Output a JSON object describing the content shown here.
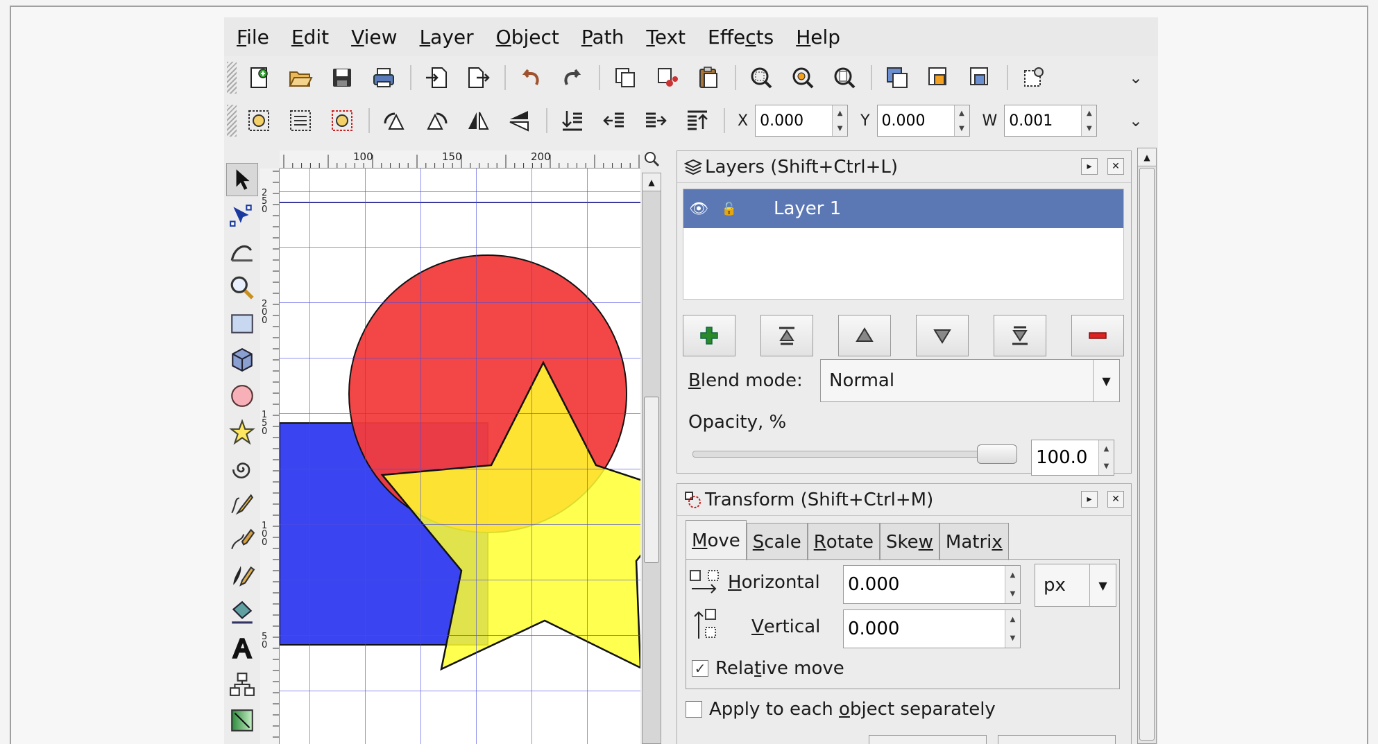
{
  "menubar": {
    "items": [
      {
        "pre": "",
        "u": "F",
        "post": "ile"
      },
      {
        "pre": "",
        "u": "E",
        "post": "dit"
      },
      {
        "pre": "",
        "u": "V",
        "post": "iew"
      },
      {
        "pre": "",
        "u": "L",
        "post": "ayer"
      },
      {
        "pre": "",
        "u": "O",
        "post": "bject"
      },
      {
        "pre": "",
        "u": "P",
        "post": "ath"
      },
      {
        "pre": "",
        "u": "T",
        "post": "ext"
      },
      {
        "pre": "Effe",
        "u": "c",
        "post": "ts"
      },
      {
        "pre": "",
        "u": "H",
        "post": "elp"
      }
    ]
  },
  "controls": {
    "x_label": "X",
    "x_value": "0.000",
    "y_label": "Y",
    "y_value": "0.000",
    "w_label": "W",
    "w_value": "0.001"
  },
  "ruler": {
    "h_labels": [
      "100",
      "150",
      "200"
    ],
    "v_labels": [
      "250",
      "200",
      "150",
      "100",
      "50"
    ]
  },
  "layers_panel": {
    "title": "Layers (Shift+Ctrl+L)",
    "layer_name": "Layer 1",
    "blend_label_u": "B",
    "blend_label_rest": "lend mode:",
    "blend_value": "Normal",
    "opacity_label": "Opacity, %",
    "opacity_value": "100.0",
    "opacity_fraction": 1.0
  },
  "transform_panel": {
    "title": "Transform (Shift+Ctrl+M)",
    "tabs": [
      {
        "u": "M",
        "rest": "ove"
      },
      {
        "u": "S",
        "rest": "cale"
      },
      {
        "u": "R",
        "rest": "otate"
      },
      {
        "pre": "Ske",
        "u": "w",
        "rest": ""
      },
      {
        "pre": "Matri",
        "u": "x",
        "rest": ""
      }
    ],
    "horizontal_u": "H",
    "horizontal_rest": "orizontal",
    "horizontal_value": "0.000",
    "unit": "px",
    "vertical_u": "V",
    "vertical_rest": "ertical",
    "vertical_value": "0.000",
    "relative_pre": "Rela",
    "relative_u": "t",
    "relative_post": "ive move",
    "relative_checked": true,
    "apply_pre": "Apply to each ",
    "apply_u": "o",
    "apply_post": "bject separately",
    "apply_checked": false
  },
  "colors": {
    "selected_layer": "#5b78b5",
    "rect_fill": "#3a44f0",
    "circle_fill": "#f24040",
    "star_fill": "#ffff3a",
    "grid": "#4a4adf"
  }
}
